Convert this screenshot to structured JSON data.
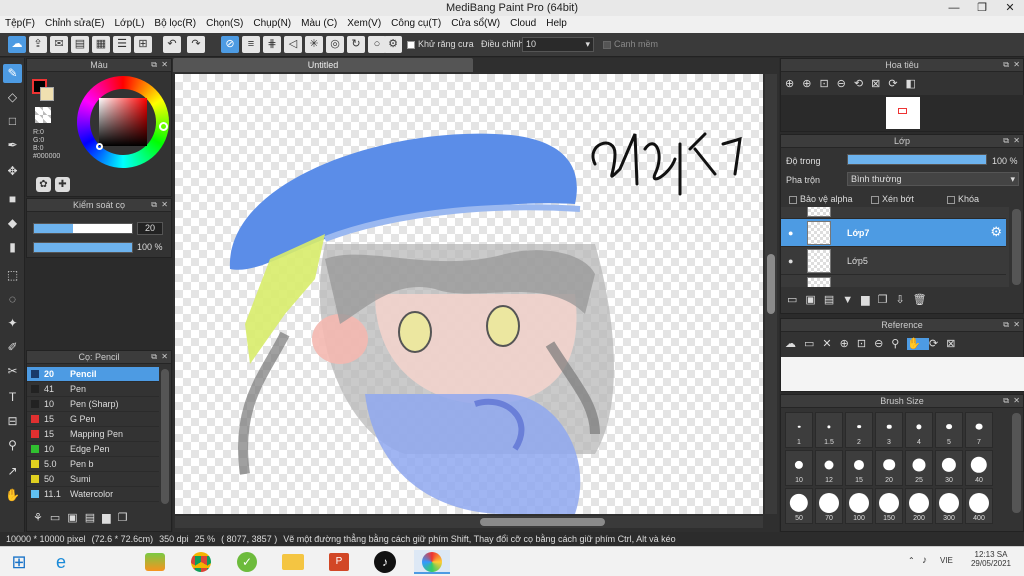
{
  "app": {
    "title": "MediBang Paint Pro (64bit)",
    "window_controls": [
      "—",
      "❐",
      "✕"
    ]
  },
  "menu": [
    "Tệp(F)",
    "Chỉnh sửa(E)",
    "Lớp(L)",
    "Bộ lọc(R)",
    "Chọn(S)",
    "Chụp(N)",
    "Màu (C)",
    "Xem(V)",
    "Công cụ(T)",
    "Cửa sổ(W)",
    "Cloud",
    "Help"
  ],
  "toolbar": {
    "antialias_label": "Khử răng cưa",
    "adjust_label": "Điều chỉnh",
    "adjust_value": "10",
    "margin_label": "Canh mềm"
  },
  "color_panel": {
    "title": "Màu",
    "r": "R:0",
    "g": "G:0",
    "b": "B:0",
    "hex": "#000000"
  },
  "brush_control": {
    "title": "Kiểm soát cọ",
    "size_value": "20",
    "opacity_value": "100 %",
    "size_fill": 0.4,
    "opacity_fill": 1.0
  },
  "brush_list": {
    "title": "Cọ: Pencil",
    "items": [
      {
        "size": "20",
        "name": "Pencil",
        "color": "#1a3a6a",
        "selected": true
      },
      {
        "size": "41",
        "name": "Pen",
        "color": "#222222"
      },
      {
        "size": "10",
        "name": "Pen (Sharp)",
        "color": "#222222"
      },
      {
        "size": "15",
        "name": "G Pen",
        "color": "#e03030"
      },
      {
        "size": "15",
        "name": "Mapping Pen",
        "color": "#e03030"
      },
      {
        "size": "10",
        "name": "Edge Pen",
        "color": "#30c030"
      },
      {
        "size": "5.0",
        "name": "Pen b",
        "color": "#e0d020"
      },
      {
        "size": "50",
        "name": "Sumi",
        "color": "#e0d020"
      },
      {
        "size": "11.1",
        "name": "Watercolor",
        "color": "#60c0f0"
      }
    ]
  },
  "document": {
    "tab": "Untitled"
  },
  "navigator": {
    "title": "Hoa tiêu"
  },
  "layers": {
    "title": "Lớp",
    "opacity_label": "Độ trong",
    "opacity_value": "100 %",
    "opacity_fill": 1.0,
    "blend_label": "Pha trộn",
    "blend_value": "Bình thường",
    "protect_alpha": "Bảo vệ alpha",
    "clipping": "Xén bớt",
    "lock": "Khóa",
    "rows": [
      {
        "name": "Lớp7",
        "selected": true
      },
      {
        "name": "Lớp5",
        "selected": false
      }
    ]
  },
  "reference": {
    "title": "Reference"
  },
  "brush_size": {
    "title": "Brush Size",
    "sizes": [
      "1",
      "1.5",
      "2",
      "3",
      "4",
      "5",
      "7",
      "10",
      "12",
      "15",
      "20",
      "25",
      "30",
      "40",
      "50",
      "70",
      "100",
      "150",
      "200",
      "300",
      "400"
    ]
  },
  "status": {
    "dimensions": "10000 * 10000 pixel",
    "physical": "(72.6 * 72.6cm)",
    "dpi": "350 dpi",
    "zoom": "25 %",
    "coords": "( 8077, 3857 )",
    "hint": "Vẽ một đường thẳng bằng cách giữ phím Shift, Thay đổi cỡ cọ bằng cách giữ phím Ctrl, Alt và kéo"
  },
  "taskbar": {
    "lang": "VIE",
    "time": "12:13 SA",
    "date": "29/05/2021"
  },
  "colors": {
    "accent": "#4d9be3",
    "hat": "#5b8de8",
    "ribbon": "#d8ec6a",
    "skin": "#f4c8c0",
    "hair": "#8a8a8a"
  }
}
